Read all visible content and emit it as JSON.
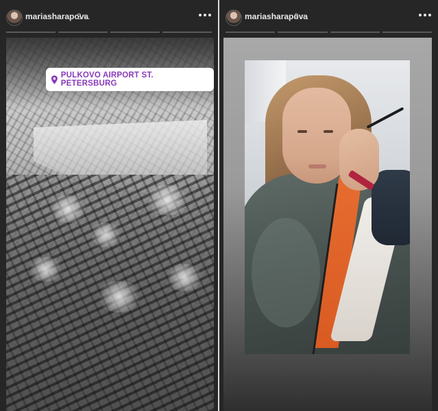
{
  "stories": [
    {
      "username": "mariasharapova",
      "time": "2 ч.",
      "progress_segments": 4,
      "location_sticker": "PULKOVO AIRPORT ST. PETERSBURG"
    },
    {
      "username": "mariasharapova",
      "time": "2 ч.",
      "progress_segments": 4
    }
  ],
  "icons": {
    "avatar": "avatar",
    "more": "more-options-icon",
    "location": "location-pin-icon"
  },
  "colors": {
    "background": "#262626",
    "sticker_text": "#8a3ab9",
    "sticker_bg": "#ffffff"
  }
}
